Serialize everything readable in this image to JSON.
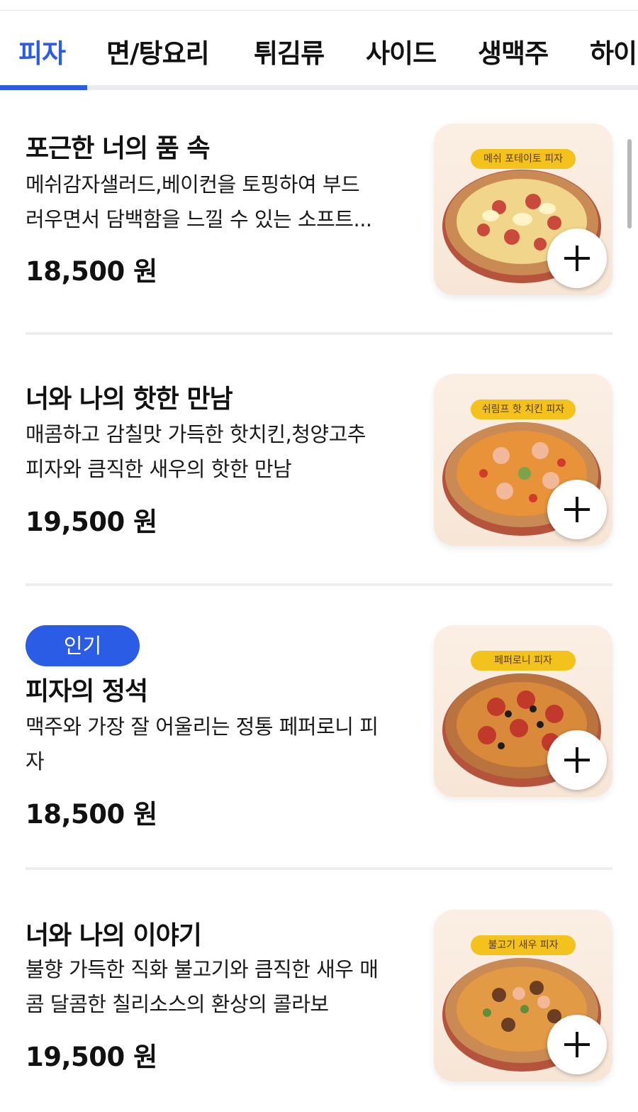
{
  "tabs": [
    {
      "label": "피자",
      "active": true
    },
    {
      "label": "면/탕요리",
      "active": false
    },
    {
      "label": "튀김류",
      "active": false
    },
    {
      "label": "사이드",
      "active": false
    },
    {
      "label": "생맥주",
      "active": false
    },
    {
      "label": "하이",
      "active": false
    }
  ],
  "colors": {
    "accent": "#2b5ce6",
    "badge": "#2b5ce6",
    "label_bg": "#f3c21c"
  },
  "items": [
    {
      "badge": "",
      "name": "포근한 너의 품 속",
      "desc_lines": [
        "메쉬감자샐러드,베이컨을 토핑하여 부드",
        "러우면서 담백함을 느낄 수 있는 소프트..."
      ],
      "price": "18,500 원",
      "image_label": "메쉬 포테이토 피자",
      "add_icon": "plus-icon"
    },
    {
      "badge": "",
      "name": "너와 나의 핫한 만남",
      "desc_lines": [
        "매콤하고 감칠맛 가득한 핫치킨,청양고추",
        "피자와 큼직한 새우의 핫한 만남"
      ],
      "price": "19,500 원",
      "image_label": "쉬림프 핫 치킨 피자",
      "add_icon": "plus-icon"
    },
    {
      "badge": "인기",
      "name": "피자의 정석",
      "desc_lines": [
        "맥주와 가장 잘 어울리는 정통 페퍼로니 피",
        "자"
      ],
      "price": "18,500 원",
      "image_label": "페퍼로니 피자",
      "add_icon": "plus-icon"
    },
    {
      "badge": "",
      "name": "너와 나의 이야기",
      "desc_lines": [
        "불향 가득한 직화 불고기와 큼직한 새우 매",
        "콤 달콤한 칠리소스의 환상의 콜라보"
      ],
      "price": "19,500 원",
      "image_label": "불고기 새우 피자",
      "add_icon": "plus-icon"
    }
  ]
}
